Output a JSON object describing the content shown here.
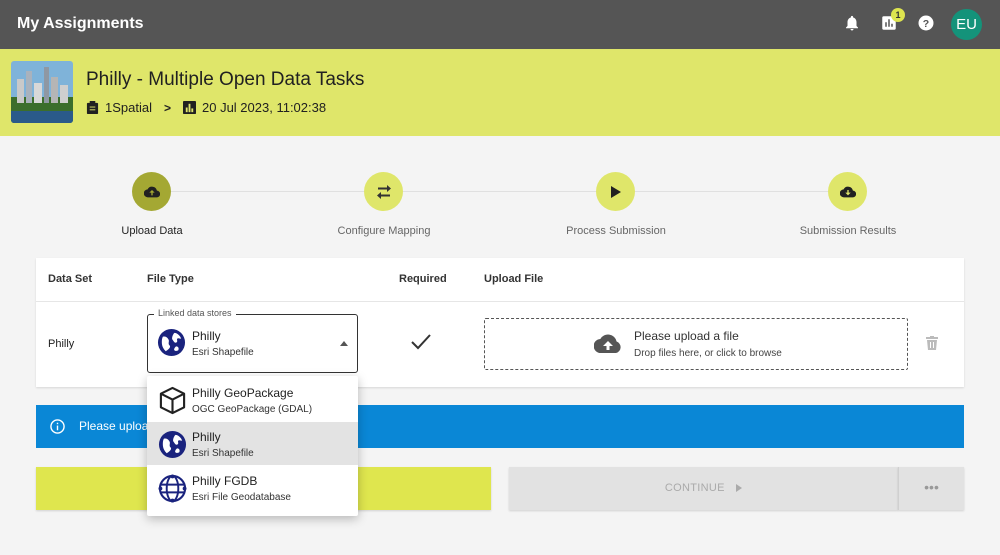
{
  "app": {
    "title": "My Assignments",
    "notification_count": "1",
    "avatar_initials": "EU"
  },
  "header": {
    "title": "Philly - Multiple Open Data Tasks",
    "organization": "1Spatial",
    "datetime": "20 Jul 2023, 11:02:38"
  },
  "stepper": {
    "steps": [
      {
        "label": "Upload Data",
        "icon": "cloud-upload-icon",
        "active": true
      },
      {
        "label": "Configure Mapping",
        "icon": "swap-icon",
        "active": false
      },
      {
        "label": "Process Submission",
        "icon": "play-icon",
        "active": false
      },
      {
        "label": "Submission Results",
        "icon": "cloud-download-icon",
        "active": false
      }
    ]
  },
  "table": {
    "headers": [
      "Data Set",
      "File Type",
      "Required",
      "Upload File"
    ],
    "row": {
      "dataset": "Philly",
      "file_type": {
        "legend": "Linked data stores",
        "name": "Philly",
        "format": "Esri Shapefile"
      },
      "required": true,
      "upload": {
        "title": "Please upload a file",
        "hint": "Drop files here, or click to browse"
      }
    }
  },
  "banner": {
    "text": "Please uploa"
  },
  "actions": {
    "continue_label": "CONTINUE",
    "more_label": "•••"
  },
  "dropdown": {
    "options": [
      {
        "name": "Philly GeoPackage",
        "format": "OGC GeoPackage (GDAL)",
        "icon": "cube-icon",
        "selected": false
      },
      {
        "name": "Philly",
        "format": "Esri Shapefile",
        "icon": "globe-icon",
        "selected": true
      },
      {
        "name": "Philly FGDB",
        "format": "Esri File Geodatabase",
        "icon": "network-globe-icon",
        "selected": false
      }
    ]
  },
  "colors": {
    "topbar": "#555555",
    "accent": "#dfe66a",
    "active_step": "#a4a833",
    "info": "#0a87d6",
    "avatar": "#14937a"
  }
}
